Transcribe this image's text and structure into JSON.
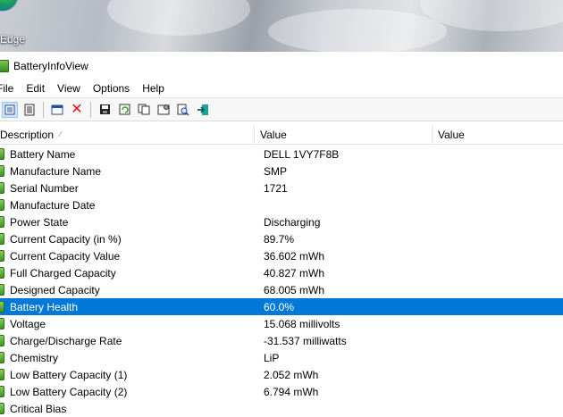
{
  "desktop": {
    "shortcut_label": "Edge"
  },
  "window": {
    "title": "BatteryInfoView"
  },
  "menu": [
    "File",
    "Edit",
    "View",
    "Options",
    "Help"
  ],
  "toolbar": {
    "buttons": [
      {
        "icon": "list-view-icon"
      },
      {
        "icon": "html-report-icon"
      },
      {
        "icon": "properties-window-icon"
      },
      {
        "icon": "delete-icon"
      },
      {
        "icon": "save-icon"
      },
      {
        "icon": "refresh-icon"
      },
      {
        "icon": "copy-icon"
      },
      {
        "icon": "options-icon"
      },
      {
        "icon": "find-icon"
      },
      {
        "icon": "exit-icon"
      }
    ]
  },
  "columns": [
    "Description",
    "Value",
    "Value"
  ],
  "rows": [
    {
      "desc": "Battery Name",
      "value": "DELL 1VY7F8B"
    },
    {
      "desc": "Manufacture Name",
      "value": "SMP"
    },
    {
      "desc": "Serial Number",
      "value": "1721"
    },
    {
      "desc": "Manufacture Date",
      "value": ""
    },
    {
      "desc": "Power State",
      "value": "Discharging"
    },
    {
      "desc": "Current Capacity (in %)",
      "value": "89.7%"
    },
    {
      "desc": "Current Capacity Value",
      "value": "36.602 mWh"
    },
    {
      "desc": "Full Charged Capacity",
      "value": "40.827 mWh"
    },
    {
      "desc": "Designed Capacity",
      "value": "68.005 mWh"
    },
    {
      "desc": "Battery Health",
      "value": "60.0%",
      "selected": true
    },
    {
      "desc": "Voltage",
      "value": "15.068 millivolts"
    },
    {
      "desc": "Charge/Discharge Rate",
      "value": "-31.537 milliwatts"
    },
    {
      "desc": "Chemistry",
      "value": "LiP"
    },
    {
      "desc": "Low Battery Capacity (1)",
      "value": "2.052 mWh"
    },
    {
      "desc": "Low Battery Capacity (2)",
      "value": "6.794 mWh"
    },
    {
      "desc": "Critical Bias",
      "value": ""
    }
  ],
  "colors": {
    "selection": "#0078d7",
    "battery_icon": "#3d931f"
  }
}
